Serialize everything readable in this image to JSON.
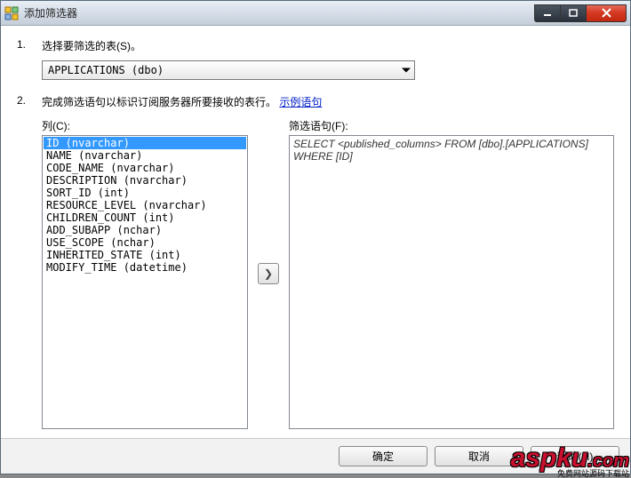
{
  "window": {
    "title": "添加筛选器"
  },
  "steps": {
    "s1_num": "1.",
    "s1_text": "选择要筛选的表(S)。",
    "s2_num": "2.",
    "s2_text_prefix": "完成筛选语句以标识订阅服务器所要接收的表行。",
    "s2_link": "示例语句"
  },
  "combo": {
    "value": "APPLICATIONS (dbo)"
  },
  "labels": {
    "columns": "列(C):",
    "filter": "筛选语句(F):"
  },
  "columns": [
    "ID (nvarchar)",
    "NAME (nvarchar)",
    "CODE_NAME (nvarchar)",
    "DESCRIPTION (nvarchar)",
    "SORT_ID (int)",
    "RESOURCE_LEVEL (nvarchar)",
    "CHILDREN_COUNT (int)",
    "ADD_SUBAPP (nchar)",
    "USE_SCOPE (nchar)",
    "INHERITED_STATE (int)",
    "MODIFY_TIME (datetime)"
  ],
  "filter_text": "SELECT <published_columns> FROM [dbo].[APPLICATIONS] WHERE [ID] ",
  "buttons": {
    "ok": "确定",
    "cancel": "取消",
    "help": "帮助(H)"
  },
  "watermark": {
    "brand": "aspku",
    "tld": ".com",
    "sub": "免费网站源码下载站"
  }
}
